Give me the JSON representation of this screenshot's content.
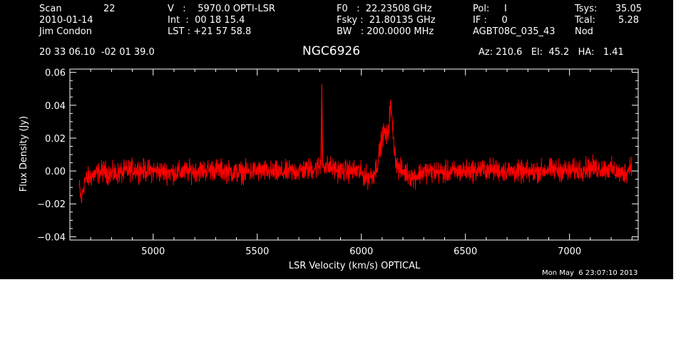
{
  "header": {
    "col1": {
      "scan_label": "Scan",
      "scan_value": "22",
      "date": "2010-01-14",
      "observer": "Jim Condon",
      "coords": "20 33 06.10  -02 01 39.0"
    },
    "col2": {
      "v_line": "V   :    5970.0 OPTI-LSR",
      "int_line": "Int  :  00 18 15.4",
      "lst_line": "LST : +21 57 58.8"
    },
    "col3": {
      "f0_line": "F0   :  22.23508 GHz",
      "fsky_line": "Fsky :  21.80135 GHz",
      "bw_line": "BW   : 200.0000 MHz"
    },
    "col4": {
      "pol_line": "Pol:     I",
      "if_line": "IF :     0",
      "proj_line": "AGBT08C_035_43"
    },
    "col5": {
      "tsys_label": "Tsys:",
      "tsys_value": "35.05",
      "tcal_label": "Tcal:",
      "tcal_value": "5.28",
      "mode": "Nod"
    },
    "source": "NGC6926",
    "pointing": "Az: 210.6   El:  45.2   HA:   1.41"
  },
  "timestamp": "Mon May  6 23:07:10 2013",
  "colors": {
    "background": "#000000",
    "axes": "#ffffff",
    "spectrum": "#ff0000"
  },
  "chart_data": {
    "type": "line",
    "title": "NGC6926",
    "xlabel": "LSR Velocity (km/s) OPTICAL",
    "ylabel": "Flux Density (Jy)",
    "xlim": [
      4600,
      7330
    ],
    "ylim": [
      -0.042,
      0.062
    ],
    "x_ticks": [
      5000,
      5500,
      6000,
      6500,
      7000
    ],
    "x_tick_labels": [
      "5000",
      "5500",
      "6000",
      "6500",
      "7000"
    ],
    "y_ticks": [
      -0.04,
      -0.02,
      0.0,
      0.02,
      0.04,
      0.06
    ],
    "y_tick_labels": [
      "−0.04",
      "−0.02",
      "0.00",
      "0.02",
      "0.04",
      "0.06"
    ],
    "grid": false,
    "series": [
      {
        "color": "#ff0000",
        "x": [
          4645,
          4655,
          4670,
          4690,
          4720,
          4760,
          4800,
          4850,
          4900,
          5000,
          5100,
          5200,
          5300,
          5400,
          5500,
          5600,
          5700,
          5790,
          5805,
          5810,
          5815,
          5830,
          5900,
          5980,
          6030,
          6060,
          6080,
          6090,
          6100,
          6110,
          6120,
          6130,
          6140,
          6145,
          6150,
          6160,
          6170,
          6180,
          6200,
          6250,
          6300,
          6400,
          6500,
          6600,
          6700,
          6800,
          6900,
          7000,
          7100,
          7200,
          7250,
          7280,
          7300
        ],
        "y": [
          -0.01,
          -0.018,
          -0.006,
          -0.004,
          -0.002,
          0.0,
          -0.002,
          -0.001,
          0.001,
          0.0,
          -0.001,
          0.0,
          0.001,
          -0.001,
          0.0,
          -0.001,
          0.0,
          0.002,
          0.004,
          0.053,
          0.004,
          0.003,
          0.0,
          0.0,
          -0.004,
          -0.002,
          0.006,
          0.014,
          0.02,
          0.024,
          0.02,
          0.025,
          0.04,
          0.035,
          0.026,
          0.012,
          0.004,
          0.001,
          0.0,
          -0.004,
          0.0,
          -0.001,
          0.0,
          0.001,
          0.0,
          -0.001,
          0.001,
          0.0,
          0.002,
          0.001,
          -0.002,
          0.0,
          0.006
        ]
      }
    ]
  }
}
